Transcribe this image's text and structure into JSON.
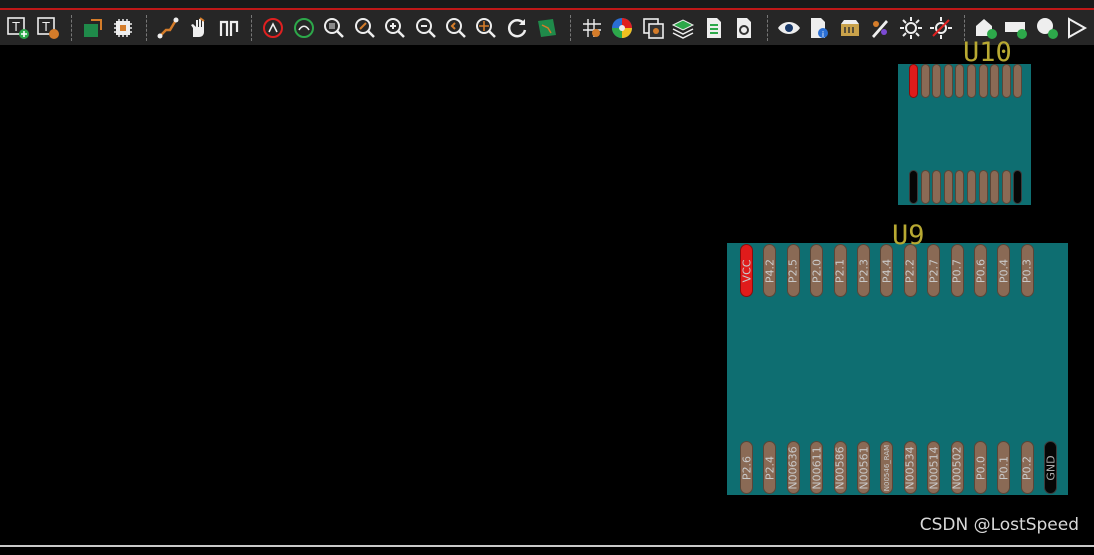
{
  "toolbar": {
    "icons": [
      "text-add-icon",
      "text-edit-icon",
      "board-icon",
      "chip-icon",
      "route-icon",
      "hand-icon",
      "differential-pair-icon",
      "drc-icon",
      "green-circle-icon",
      "zoom-fit-icon",
      "zoom-selection-icon",
      "zoom-in-icon",
      "zoom-out-icon",
      "zoom-prev-icon",
      "zoom-center-icon",
      "refresh-icon",
      "pcb-view-icon",
      "grid-icon",
      "color-wheel-icon",
      "layer-view-icon",
      "layers-icon",
      "bom-icon",
      "settings-doc-icon",
      "eye-icon",
      "info-doc-icon",
      "3d-box-icon",
      "paint-icon",
      "highlight-sun-icon",
      "clear-highlight-icon",
      "add-shape-icon",
      "add-rect-icon",
      "add-circle-icon",
      "play-icon"
    ]
  },
  "footprints": {
    "u10": {
      "ref": "U10"
    },
    "u9": {
      "ref": "U9",
      "top_pads": [
        "VCC",
        "P4.2",
        "P2.5",
        "P2.0",
        "P2.1",
        "P2.3",
        "P4.4",
        "P2.2",
        "P2.7",
        "P0.7",
        "P0.6",
        "P0.4",
        "P0.3"
      ],
      "bottom_pads": [
        "P2.6",
        "P2.4",
        "N00636",
        "N00611",
        "N00586",
        "N00561",
        "N00546_RAM",
        "N00534",
        "N00514",
        "N00502",
        "P0.0",
        "P0.1",
        "P0.2",
        "GND"
      ]
    }
  },
  "colors": {
    "board": "#0e6e71",
    "pad": "#8a6a55",
    "vcc_pad": "#e01b1b",
    "gnd_pad": "#060606",
    "ref_text": "#b8a932"
  },
  "watermark": "CSDN @LostSpeed"
}
